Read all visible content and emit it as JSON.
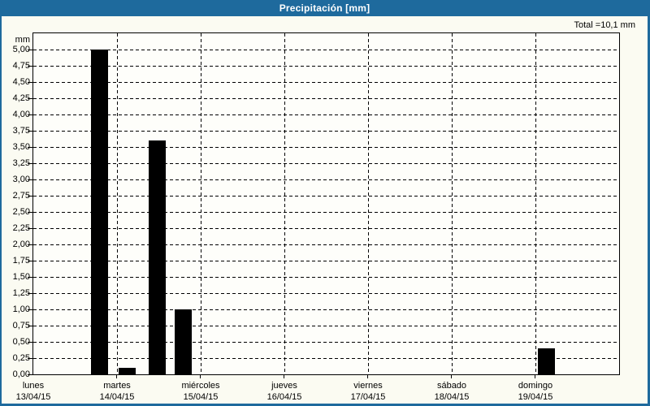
{
  "window": {
    "title": "Precipitación [mm]"
  },
  "chart_data": {
    "type": "bar",
    "title": "Precipitación [mm]",
    "total_label": "Total =10,1 mm",
    "total_mm": 10.1,
    "unit_label": "mm",
    "ylim": [
      0,
      5.25
    ],
    "ytick_step": 0.25,
    "ytick_labels": [
      "0,00",
      "0,25",
      "0,50",
      "0,75",
      "1,00",
      "1,25",
      "1,50",
      "1,75",
      "2,00",
      "2,25",
      "2,50",
      "2,75",
      "3,00",
      "3,25",
      "3,50",
      "3,75",
      "4,00",
      "4,25",
      "4,50",
      "4,75",
      "5,00"
    ],
    "grid": "dashed",
    "legend": "none",
    "bar_color": "#000000",
    "timeline_span_days": 7,
    "axis_days": [
      {
        "name": "lunes",
        "date": "13/04/15"
      },
      {
        "name": "martes",
        "date": "14/04/15"
      },
      {
        "name": "miércoles",
        "date": "15/04/15"
      },
      {
        "name": "jueves",
        "date": "16/04/15"
      },
      {
        "name": "viernes",
        "date": "17/04/15"
      },
      {
        "name": "sábado",
        "date": "18/04/15"
      },
      {
        "name": "domingo",
        "date": "19/04/15"
      }
    ],
    "bar_width_days": 0.2,
    "bars": [
      {
        "day_offset": 0.796,
        "value": 5.0
      },
      {
        "day_offset": 1.126,
        "value": 0.1
      },
      {
        "day_offset": 1.476,
        "value": 3.6
      },
      {
        "day_offset": 1.796,
        "value": 1.0
      },
      {
        "day_offset": 6.131,
        "value": 0.4
      }
    ]
  },
  "colors": {
    "titlebar": "#1e6a9d",
    "titlebar_text": "#ffffff",
    "window_bg": "#fbfbf2",
    "plot_bg": "#fefefa",
    "frame_border": "#1e6a9d",
    "axis": "#000000",
    "bar": "#000000",
    "text": "#000000"
  }
}
